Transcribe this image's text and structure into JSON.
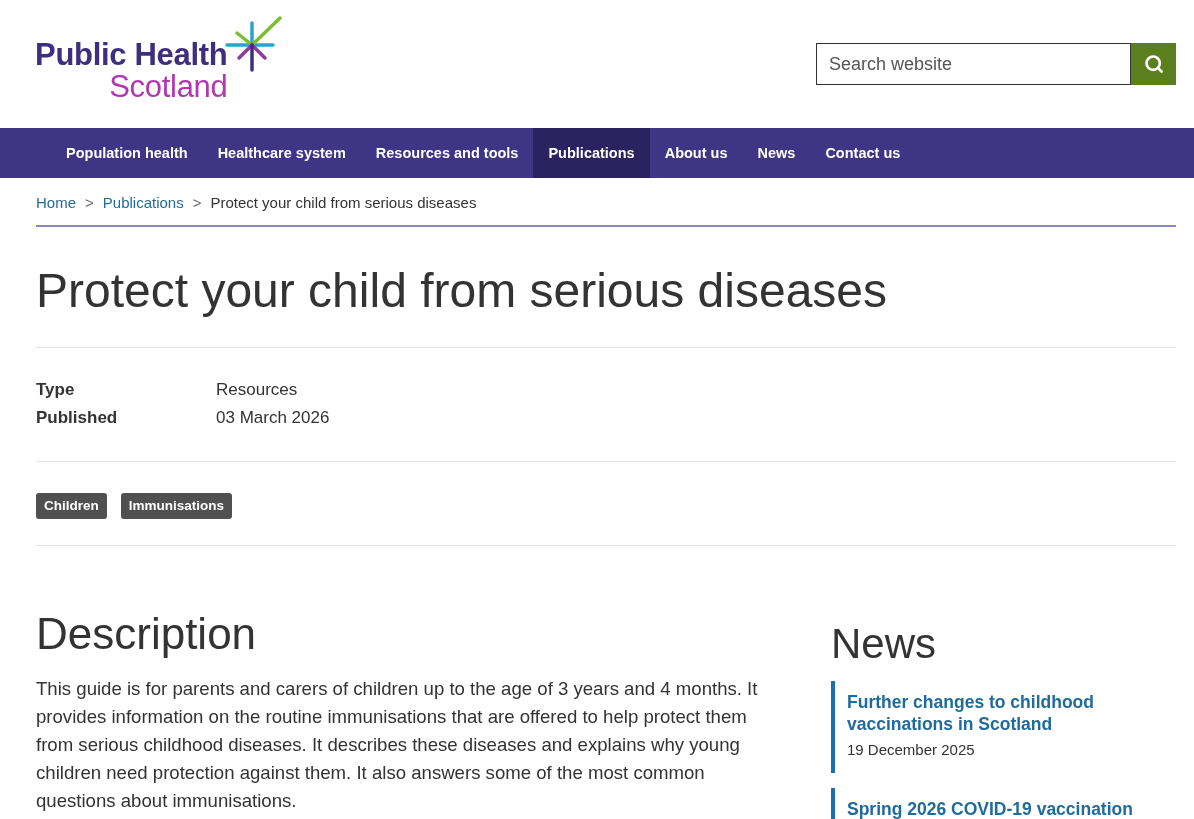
{
  "header": {
    "logo": {
      "line1": "Public Health",
      "line2": "Scotland"
    },
    "search": {
      "placeholder": "Search website"
    }
  },
  "nav": [
    {
      "label": "Population health",
      "selected": false
    },
    {
      "label": "Healthcare system",
      "selected": false
    },
    {
      "label": "Resources and tools",
      "selected": false
    },
    {
      "label": "Publications",
      "selected": true
    },
    {
      "label": "About us",
      "selected": false
    },
    {
      "label": "News",
      "selected": false
    },
    {
      "label": "Contact us",
      "selected": false
    }
  ],
  "breadcrumb": [
    {
      "kind": "link",
      "label": "Home"
    },
    {
      "kind": "separator",
      "label": ">"
    },
    {
      "kind": "link",
      "label": "Publications"
    },
    {
      "kind": "separator",
      "label": ">"
    },
    {
      "kind": "current",
      "label": "Protect your child from serious diseases"
    }
  ],
  "title": "Protect your child from serious diseases",
  "meta": [
    {
      "label": "Type",
      "value": "Resources"
    },
    {
      "label": "Published",
      "value": "03 March 2026"
    }
  ],
  "tags": [
    "Children",
    "Immunisations"
  ],
  "description": {
    "heading": "Description",
    "text": "This guide is for parents and carers of children up to the age of 3 years and 4 months. It provides information on the routine immunisations that are offered to help protect them from serious childhood diseases. It describes these diseases and explains why young children need protection against them. It also answers some of the most common questions about immunisations."
  },
  "news": {
    "heading": "News",
    "items": [
      {
        "title": "Further changes to childhood vaccinations in Scotland",
        "date": "19 December 2025"
      },
      {
        "title": "Spring 2026 COVID-19 vaccination"
      }
    ]
  }
}
